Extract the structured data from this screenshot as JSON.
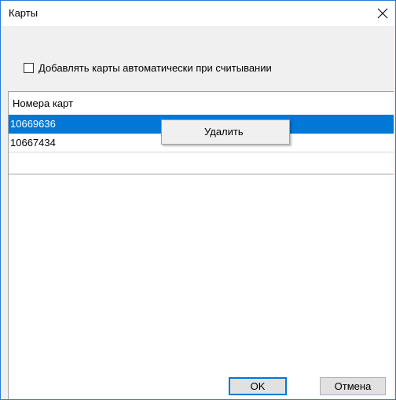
{
  "window": {
    "title": "Карты",
    "close_glyph": "✕"
  },
  "options": {
    "auto_add_label": "Добавлять карты автоматически при считывании",
    "auto_add_checked": false
  },
  "list": {
    "column_header": "Номера карт",
    "rows": [
      {
        "value": "10669636",
        "selected": true
      },
      {
        "value": "10667434",
        "selected": false
      }
    ]
  },
  "context_menu": {
    "items": [
      {
        "label": "Удалить"
      }
    ]
  },
  "buttons": {
    "ok_label": "OK",
    "cancel_label": "Отмена"
  },
  "colors": {
    "accent": "#0078d7",
    "window_border": "#2b7bd6",
    "dialog_bg": "#f0f0f0"
  },
  "icons": {
    "close": "close-icon"
  }
}
